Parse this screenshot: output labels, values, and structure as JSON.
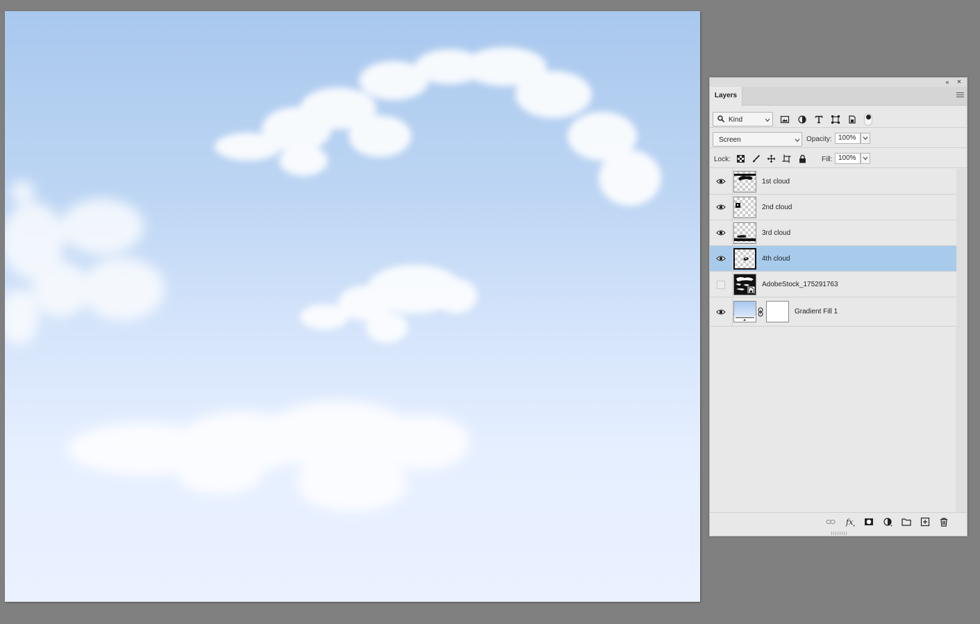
{
  "panel": {
    "tab_label": "Layers",
    "collapse_glyph": "«",
    "close_glyph": "×",
    "filter": {
      "kind_label": "Kind",
      "icons": [
        "image-filter-icon",
        "adjustment-filter-icon",
        "type-filter-icon",
        "shape-filter-icon",
        "smart-object-filter-icon"
      ]
    },
    "blend_mode": "Screen",
    "opacity_label": "Opacity:",
    "opacity_value": "100%",
    "lock_label": "Lock:",
    "fill_label": "Fill:",
    "fill_value": "100%",
    "layers": [
      {
        "name": "1st cloud",
        "visible": true,
        "selected": false
      },
      {
        "name": "2nd cloud",
        "visible": true,
        "selected": false
      },
      {
        "name": "3rd cloud",
        "visible": true,
        "selected": false
      },
      {
        "name": "4th cloud",
        "visible": true,
        "selected": true
      },
      {
        "name": "AdobeStock_175291763",
        "visible": false,
        "selected": false
      },
      {
        "name": "Gradient Fill 1",
        "visible": true,
        "selected": false
      }
    ],
    "footer_icons": [
      "link-icon",
      "fx-icon",
      "mask-icon",
      "adjustment-icon",
      "folder-icon",
      "new-layer-icon",
      "trash-icon"
    ]
  },
  "colors": {
    "selection": "#a8cbec",
    "panel_bg": "#e8e8e8",
    "workspace": "#808080",
    "sky_top": "#a9c8ee",
    "sky_bottom": "#eaf1ff"
  }
}
